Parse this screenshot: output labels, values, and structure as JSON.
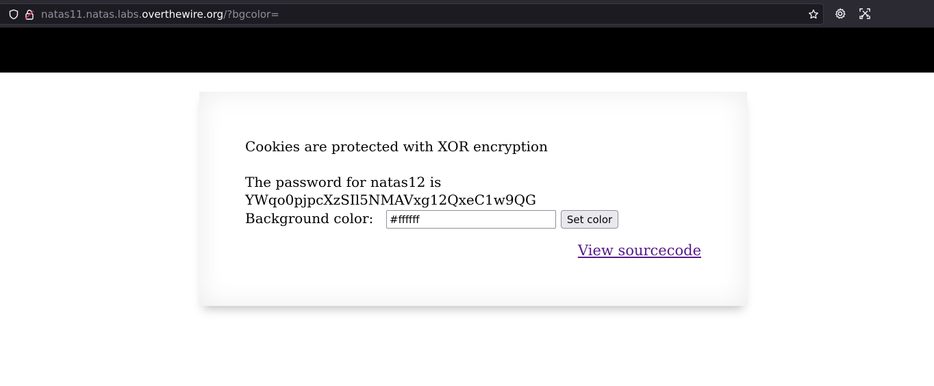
{
  "browser": {
    "url_prefix": "natas11.natas.labs.",
    "url_domain": "overthewire.org",
    "url_path": "/?bgcolor="
  },
  "icons": {
    "site_info": "shield-icon",
    "connection": "lock-icon",
    "bookmark": "star-icon",
    "settings": "gear-icon",
    "extension": "screenshot-icon"
  },
  "page": {
    "intro": "Cookies are protected with XOR encryption",
    "password_line": "The password for natas12 is",
    "password": "YWqo0pjpcXzSIl5NMAVxg12QxeC1w9QG",
    "bg_label": "Background color:",
    "bg_value": "#ffffff",
    "set_button": "Set color",
    "view_source": "View sourcecode"
  },
  "colors": {
    "header": "#000000",
    "link": "#551a8b"
  }
}
